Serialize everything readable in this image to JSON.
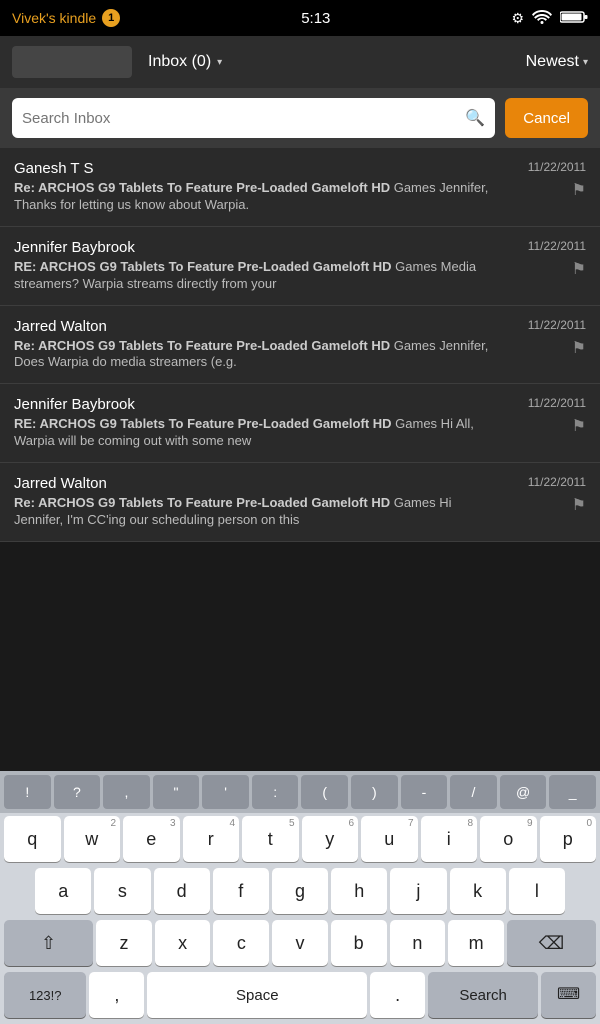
{
  "statusBar": {
    "appTitle": "Vivek's ",
    "appTitleAccent": "kindle",
    "notificationCount": "1",
    "time": "5:13"
  },
  "topBar": {
    "inboxLabel": "Inbox (0)",
    "dropdownArrow": "▾",
    "newestLabel": "Newest",
    "newestArrow": "▾"
  },
  "searchBar": {
    "placeholder": "Search Inbox",
    "cancelLabel": "Cancel",
    "searchIcon": "🔍"
  },
  "emails": [
    {
      "sender": "Ganesh T S",
      "date": "11/22/2011",
      "subjectBold": "Re: ARCHOS G9 Tablets To Feature Pre-Loaded Gameloft HD",
      "subjectBoldSuffix": " Games",
      "preview": " Jennifer, Thanks for letting us know about Warpia."
    },
    {
      "sender": "Jennifer Baybrook",
      "date": "11/22/2011",
      "subjectBold": "RE: ARCHOS G9 Tablets To Feature Pre-Loaded Gameloft HD",
      "subjectBoldSuffix": " Games",
      "preview": " Media streamers? Warpia streams directly from your"
    },
    {
      "sender": "Jarred Walton",
      "date": "11/22/2011",
      "subjectBold": "Re: ARCHOS G9 Tablets To Feature Pre-Loaded Gameloft HD",
      "subjectBoldSuffix": " Games",
      "preview": " Jennifer, Does Warpia do media streamers (e.g."
    },
    {
      "sender": "Jennifer Baybrook",
      "date": "11/22/2011",
      "subjectBold": "RE: ARCHOS G9 Tablets To Feature Pre-Loaded Gameloft HD",
      "subjectBoldSuffix": " Games",
      "preview": " Hi All, Warpia will be coming out with some new"
    },
    {
      "sender": "Jarred Walton",
      "date": "11/22/2011",
      "subjectBold": "Re: ARCHOS G9 Tablets To Feature Pre-Loaded Gameloft HD",
      "subjectBoldSuffix": " Games",
      "preview": " Hi Jennifer, I'm CC'ing our scheduling person on this"
    }
  ],
  "keyboard": {
    "specialKeys": [
      "!",
      "?",
      ",",
      "\"",
      "'",
      ":",
      "(",
      ")",
      "-",
      "/",
      "@",
      "_"
    ],
    "row1": [
      {
        "letter": "q",
        "num": ""
      },
      {
        "letter": "w",
        "num": "2"
      },
      {
        "letter": "e",
        "num": "3"
      },
      {
        "letter": "r",
        "num": "4"
      },
      {
        "letter": "t",
        "num": "5"
      },
      {
        "letter": "y",
        "num": "6"
      },
      {
        "letter": "u",
        "num": "7"
      },
      {
        "letter": "i",
        "num": "8"
      },
      {
        "letter": "o",
        "num": "9"
      },
      {
        "letter": "p",
        "num": "0"
      }
    ],
    "row2": [
      {
        "letter": "a"
      },
      {
        "letter": "s"
      },
      {
        "letter": "d"
      },
      {
        "letter": "f"
      },
      {
        "letter": "g"
      },
      {
        "letter": "h"
      },
      {
        "letter": "j"
      },
      {
        "letter": "k"
      },
      {
        "letter": "l"
      }
    ],
    "row3": [
      {
        "letter": "z"
      },
      {
        "letter": "x"
      },
      {
        "letter": "c"
      },
      {
        "letter": "v"
      },
      {
        "letter": "b"
      },
      {
        "letter": "n"
      },
      {
        "letter": "m"
      }
    ],
    "bottomRow": {
      "sym": "123!?",
      "comma": ",",
      "space": "Space",
      "dot": ".",
      "search": "Search"
    }
  }
}
